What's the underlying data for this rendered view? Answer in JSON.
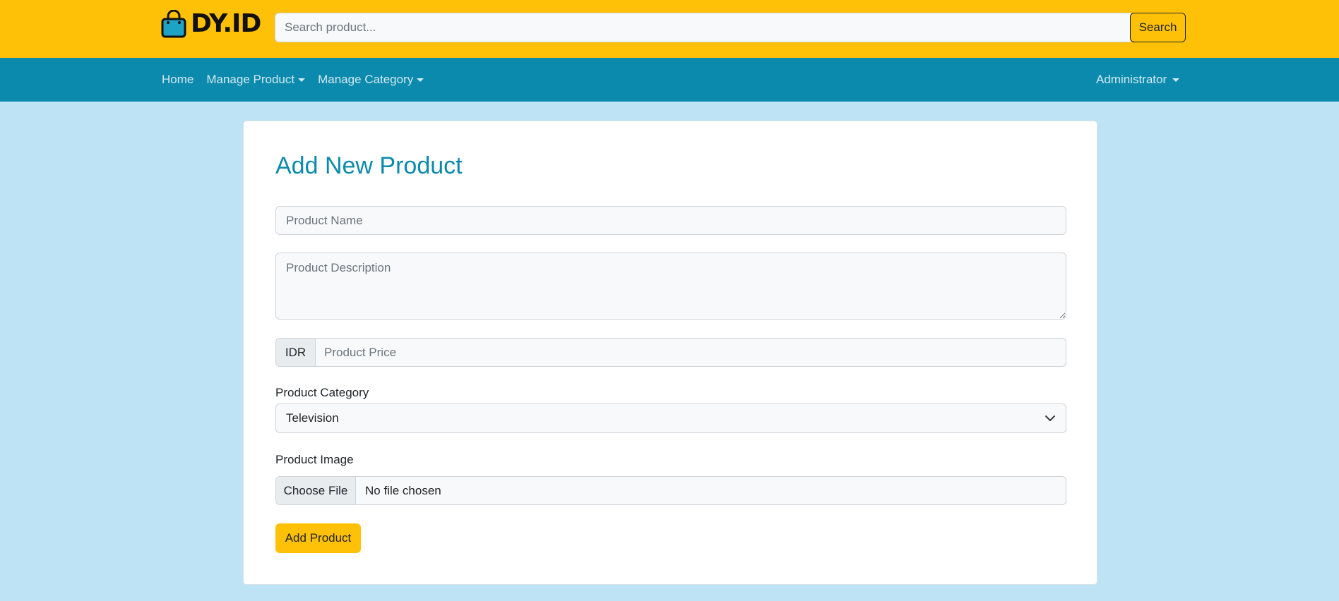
{
  "header": {
    "brand": "DY.ID",
    "search": {
      "placeholder": "Search product...",
      "button_label": "Search"
    }
  },
  "nav": {
    "home": "Home",
    "manage_product": "Manage Product",
    "manage_category": "Manage Category",
    "user_menu": "Administrator"
  },
  "form": {
    "title": "Add New Product",
    "name_placeholder": "Product Name",
    "description_placeholder": "Product Description",
    "price_prefix": "IDR",
    "price_placeholder": "Product Price",
    "category_label": "Product Category",
    "category_selected": "Television",
    "image_label": "Product Image",
    "file_button": "Choose File",
    "file_status": "No file chosen",
    "submit_label": "Add Product"
  },
  "colors": {
    "topbar": "#ffc107",
    "navbar": "#0b8aad",
    "page_background": "#bde3f5",
    "title": "#0b8aad",
    "accent_button": "#ffc107"
  },
  "icons": {
    "brand": "shopping-bag-icon",
    "select": "chevron-down-icon"
  }
}
